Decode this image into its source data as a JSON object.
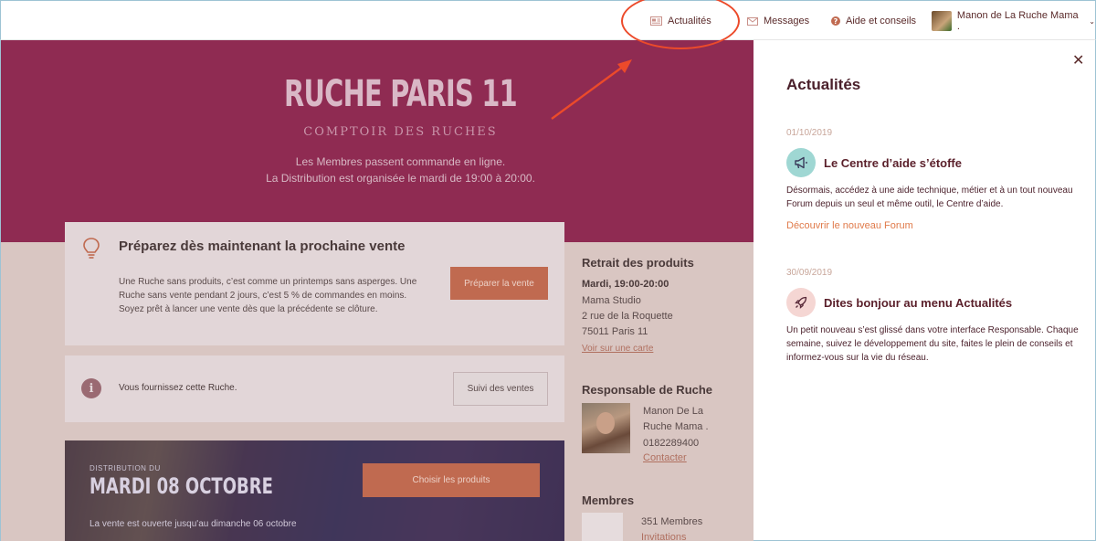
{
  "nav": {
    "news": "Actualités",
    "messages": "Messages",
    "help": "Aide et conseils",
    "user": "Manon de La Ruche Mama ."
  },
  "hero": {
    "title": "RUCHE PARIS 11",
    "subtitle": "COMPTOIR DES RUCHES",
    "line1": "Les Membres passent commande en ligne.",
    "line2": "La Distribution est organisée le mardi de 19:00 à 20:00."
  },
  "prepare": {
    "title": "Préparez dès maintenant la prochaine vente",
    "text": "Une Ruche sans produits, c’est comme un printemps sans asperges. Une Ruche sans vente pendant 2 jours, c’est 5 % de commandes en moins. Soyez prêt à lancer une vente dès que la précédente se clôture.",
    "button": "Préparer la vente"
  },
  "supplier": {
    "text": "Vous fournissez cette Ruche.",
    "button": "Suivi des ventes"
  },
  "distribution": {
    "label": "DISTRIBUTION DU",
    "date": "MARDI 08 OCTOBRE",
    "open": "La vente est ouverte jusqu'au dimanche 06 octobre",
    "button": "Choisir les produits"
  },
  "pickup": {
    "title": "Retrait des produits",
    "time": "Mardi, 19:00-20:00",
    "place": "Mama Studio",
    "address": "2 rue de la Roquette",
    "city": "75011 Paris 11",
    "map_link": "Voir sur une carte"
  },
  "manager": {
    "title": "Responsable de Ruche",
    "name1": "Manon De La",
    "name2": "Ruche Mama .",
    "phone": "0182289400",
    "contact": "Contacter"
  },
  "members": {
    "title": "Membres",
    "count": "351 Membres",
    "invite": "Invitations"
  },
  "panel": {
    "title": "Actualités",
    "items": [
      {
        "date": "01/10/2019",
        "title": "Le Centre d’aide s’étoffe",
        "body": "Désormais, accédez à une aide technique, métier et à un tout nouveau Forum depuis un seul et même outil, le Centre d’aide.",
        "link": "Découvrir le nouveau Forum",
        "icon": "megaphone-icon"
      },
      {
        "date": "30/09/2019",
        "title": "Dites bonjour au menu Actualités",
        "body": "Un petit nouveau s’est glissé dans votre interface Responsable. Chaque semaine, suivez le développement du site, faites le plein de conseils et informez-vous sur la vie du réseau.",
        "icon": "rocket-icon"
      }
    ]
  },
  "colors": {
    "hero": "#8f2b52",
    "accent": "#e07a4a",
    "annotation": "#ec4a2a"
  }
}
